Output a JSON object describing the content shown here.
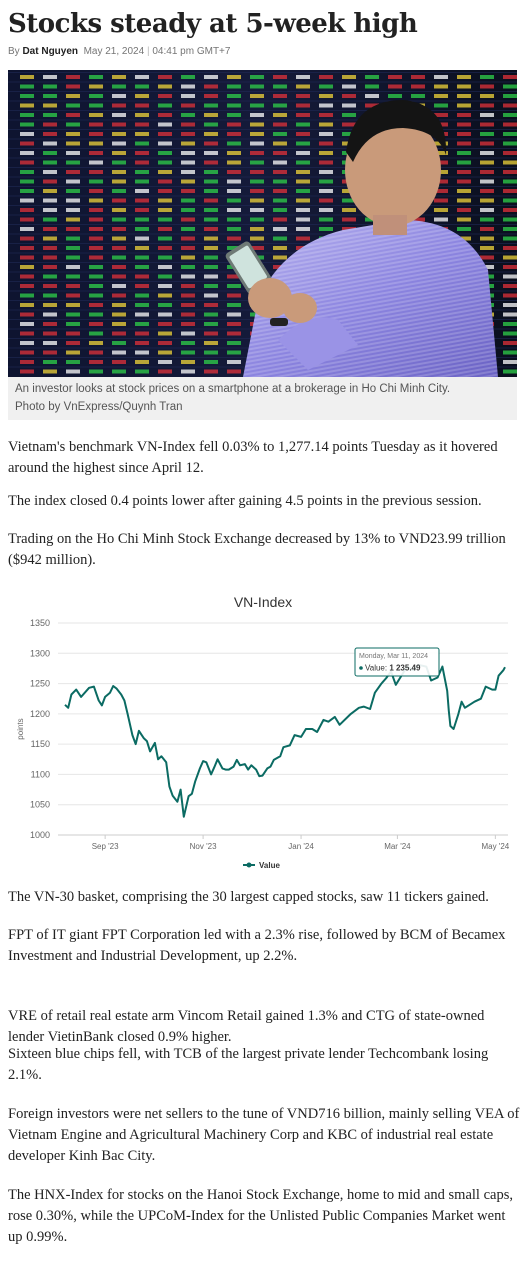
{
  "article": {
    "title": "Stocks steady at 5-week high",
    "byline_prefix": "By",
    "author": "Dat Nguyen",
    "date": "May 21, 2024",
    "separator": "|",
    "time": "04:41 pm GMT+7",
    "photo": {
      "description_icon": "investor-on-smartphone-photo",
      "caption_line1": "An investor looks at stock prices on a smartphone at a brokerage in Ho Chi Minh City.",
      "caption_line2": "Photo by VnExpress/Quynh Tran"
    },
    "paragraphs": [
      "Vietnam's benchmark VN-Index fell 0.03% to 1,277.14 points Tuesday as it hovered around the highest since April 12.",
      "The index closed 0.4 points lower after gaining 4.5 points in the previous session.",
      "Trading on the Ho Chi Minh Stock Exchange decreased by 13% to VND23.99 trillion ($942 million).",
      "The VN-30 basket, comprising the 30 largest capped stocks, saw 11 tickers gained.",
      "FPT of IT giant FPT Corporation led with a 2.3% rise, followed by BCM of Becamex Investment and Industrial Development, up 2.2%.",
      "VRE of retail real estate arm Vincom Retail gained 1.3% and CTG of state-owned lender VietinBank closed 0.9% higher.",
      "Sixteen blue chips fell, with TCB of the largest private lender Techcombank losing 2.1%.",
      "Foreign investors were net sellers to the tune of VND716 billion, mainly selling VEA of Vietnam Engine and Agricultural Machinery Corp and KBC of industrial real estate developer Kinh Bac City.",
      "The HNX-Index for stocks on the Hanoi Stock Exchange, home to mid and small caps, rose 0.30%, while the UPCoM-Index for the Unlisted Public Companies Market went up 0.99%."
    ]
  },
  "chart_data": {
    "type": "line",
    "title": "VN-Index",
    "ylabel": "points",
    "xlabel": "",
    "ylim": [
      1000,
      1350
    ],
    "yticks": [
      1000,
      1050,
      1100,
      1150,
      1200,
      1250,
      1300,
      1350
    ],
    "xticks": [
      "Sep '23",
      "Nov '23",
      "Jan '24",
      "Mar '24",
      "May '24"
    ],
    "grid": true,
    "legend_position": "bottom",
    "color": "#0b6b63",
    "series": [
      {
        "name": "Value",
        "x": [
          "2023-08-21",
          "2023-08-23",
          "2023-08-25",
          "2023-08-28",
          "2023-08-31",
          "2023-09-05",
          "2023-09-08",
          "2023-09-11",
          "2023-09-13",
          "2023-09-15",
          "2023-09-18",
          "2023-09-20",
          "2023-09-22",
          "2023-09-25",
          "2023-09-27",
          "2023-09-29",
          "2023-10-02",
          "2023-10-04",
          "2023-10-06",
          "2023-10-09",
          "2023-10-11",
          "2023-10-13",
          "2023-10-16",
          "2023-10-18",
          "2023-10-20",
          "2023-10-23",
          "2023-10-25",
          "2023-10-27",
          "2023-10-30",
          "2023-11-01",
          "2023-11-03",
          "2023-11-06",
          "2023-11-08",
          "2023-11-10",
          "2023-11-13",
          "2023-11-15",
          "2023-11-17",
          "2023-11-20",
          "2023-11-22",
          "2023-11-24",
          "2023-11-27",
          "2023-11-29",
          "2023-12-01",
          "2023-12-04",
          "2023-12-06",
          "2023-12-08",
          "2023-12-11",
          "2023-12-13",
          "2023-12-15",
          "2023-12-18",
          "2023-12-20",
          "2023-12-22",
          "2023-12-25",
          "2023-12-27",
          "2023-12-29",
          "2024-01-02",
          "2024-01-04",
          "2024-01-08",
          "2024-01-11",
          "2024-01-15",
          "2024-01-18",
          "2024-01-22",
          "2024-01-25",
          "2024-01-29",
          "2024-02-01",
          "2024-02-05",
          "2024-02-08",
          "2024-02-15",
          "2024-02-20",
          "2024-02-23",
          "2024-02-27",
          "2024-03-01",
          "2024-03-05",
          "2024-03-08",
          "2024-03-11",
          "2024-03-14",
          "2024-03-18",
          "2024-03-21",
          "2024-03-25",
          "2024-03-28",
          "2024-04-02",
          "2024-04-05",
          "2024-04-09",
          "2024-04-12",
          "2024-04-15",
          "2024-04-16",
          "2024-04-17",
          "2024-04-19",
          "2024-04-22",
          "2024-04-24",
          "2024-04-26",
          "2024-05-02",
          "2024-05-06",
          "2024-05-09",
          "2024-05-13",
          "2024-05-15",
          "2024-05-17",
          "2024-05-20",
          "2024-05-21"
        ],
        "values": [
          1215,
          1210,
          1232,
          1240,
          1228,
          1243,
          1245,
          1222,
          1214,
          1228,
          1235,
          1246,
          1242,
          1232,
          1222,
          1200,
          1165,
          1150,
          1172,
          1160,
          1155,
          1138,
          1152,
          1125,
          1130,
          1120,
          1080,
          1065,
          1055,
          1075,
          1030,
          1064,
          1068,
          1088,
          1110,
          1122,
          1120,
          1100,
          1112,
          1125,
          1110,
          1108,
          1108,
          1113,
          1124,
          1115,
          1117,
          1108,
          1115,
          1108,
          1097,
          1098,
          1110,
          1113,
          1124,
          1130,
          1145,
          1148,
          1165,
          1162,
          1175,
          1175,
          1170,
          1190,
          1187,
          1195,
          1182,
          1200,
          1210,
          1212,
          1208,
          1235,
          1250,
          1259,
          1270,
          1248,
          1265,
          1278,
          1272,
          1281,
          1278,
          1255,
          1260,
          1278,
          1238,
          1205,
          1180,
          1175,
          1200,
          1220,
          1210,
          1220,
          1225,
          1245,
          1240,
          1240,
          1263,
          1272,
          1277
        ]
      }
    ],
    "tooltip": {
      "date": "Monday, Mar 11, 2024",
      "label": "Value:",
      "value": "1 235.49"
    }
  },
  "colors": {
    "text": "#222222",
    "muted": "#757575",
    "caption_bg": "#f0f0f0",
    "line": "#0b6b63",
    "grid": "#e6e6e6"
  }
}
